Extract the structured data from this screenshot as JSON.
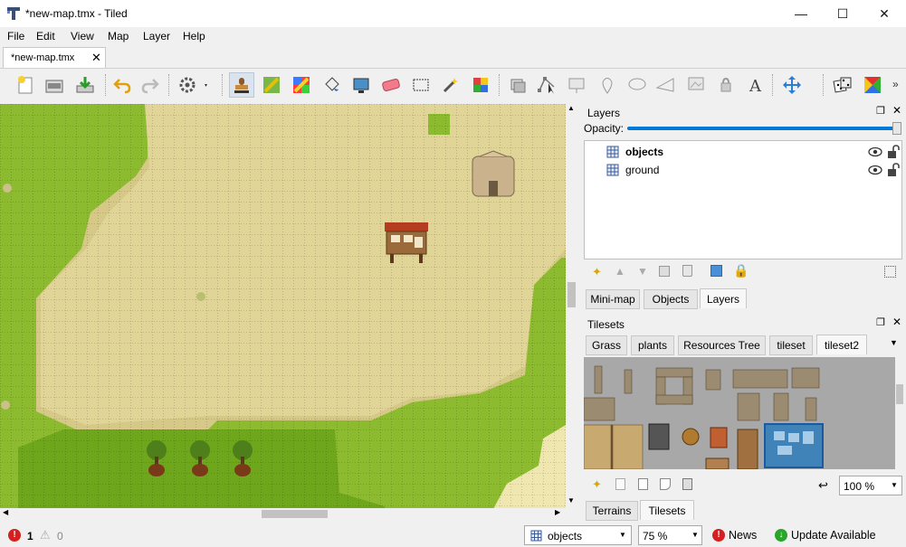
{
  "window": {
    "title": "*new-map.tmx - Tiled",
    "controls": [
      "—",
      "☐",
      "✕"
    ]
  },
  "menu": [
    {
      "label": "File"
    },
    {
      "label": "Edit"
    },
    {
      "label": "View"
    },
    {
      "label": "Map"
    },
    {
      "label": "Layer"
    },
    {
      "label": "Help"
    }
  ],
  "document_tab": {
    "label": "*new-map.tmx",
    "close": "✕"
  },
  "toolbar": {
    "buttons": [
      "new-map",
      "open",
      "save",
      "undo",
      "redo",
      "commands",
      "stamp-brush",
      "terrain-brush",
      "bucket-fill",
      "shape-fill",
      "eraser",
      "rectangular-select",
      "magic-wand",
      "select-same-tile",
      "select-objects",
      "edit-polygons",
      "insert-rectangle",
      "insert-point",
      "insert-ellipse",
      "insert-polygon",
      "insert-tile",
      "insert-template",
      "insert-text",
      "move",
      "random-mode",
      "wang-tool"
    ],
    "overflow": "»"
  },
  "layers_panel": {
    "title": "Layers",
    "opacity_label": "Opacity:",
    "opacity": 1.0,
    "layers": [
      {
        "name": "objects",
        "selected": true,
        "visible": true,
        "locked": false
      },
      {
        "name": "ground",
        "selected": false,
        "visible": true,
        "locked": false
      }
    ],
    "tabs": [
      "Mini-map",
      "Objects",
      "Layers"
    ],
    "active_tab": "Layers"
  },
  "tilesets_panel": {
    "title": "Tilesets",
    "tabs": [
      "Grass",
      "plants",
      "Resources Tree",
      "tileset",
      "tileset2"
    ],
    "active_tab": "tileset2",
    "zoom": "100 %",
    "bottom_tabs": [
      "Terrains",
      "Tilesets"
    ],
    "active_bottom_tab": "Tilesets"
  },
  "status": {
    "errors": "1",
    "warnings": "0",
    "layer_select": "objects",
    "zoom": "75 %",
    "news": "News",
    "update": "Update Available"
  },
  "colors": {
    "grass": "#8cbb2f",
    "dark_grass": "#6ea61c",
    "sand": "#d6c987",
    "light_sand": "#e8de9e",
    "accent": "#0078d7"
  }
}
